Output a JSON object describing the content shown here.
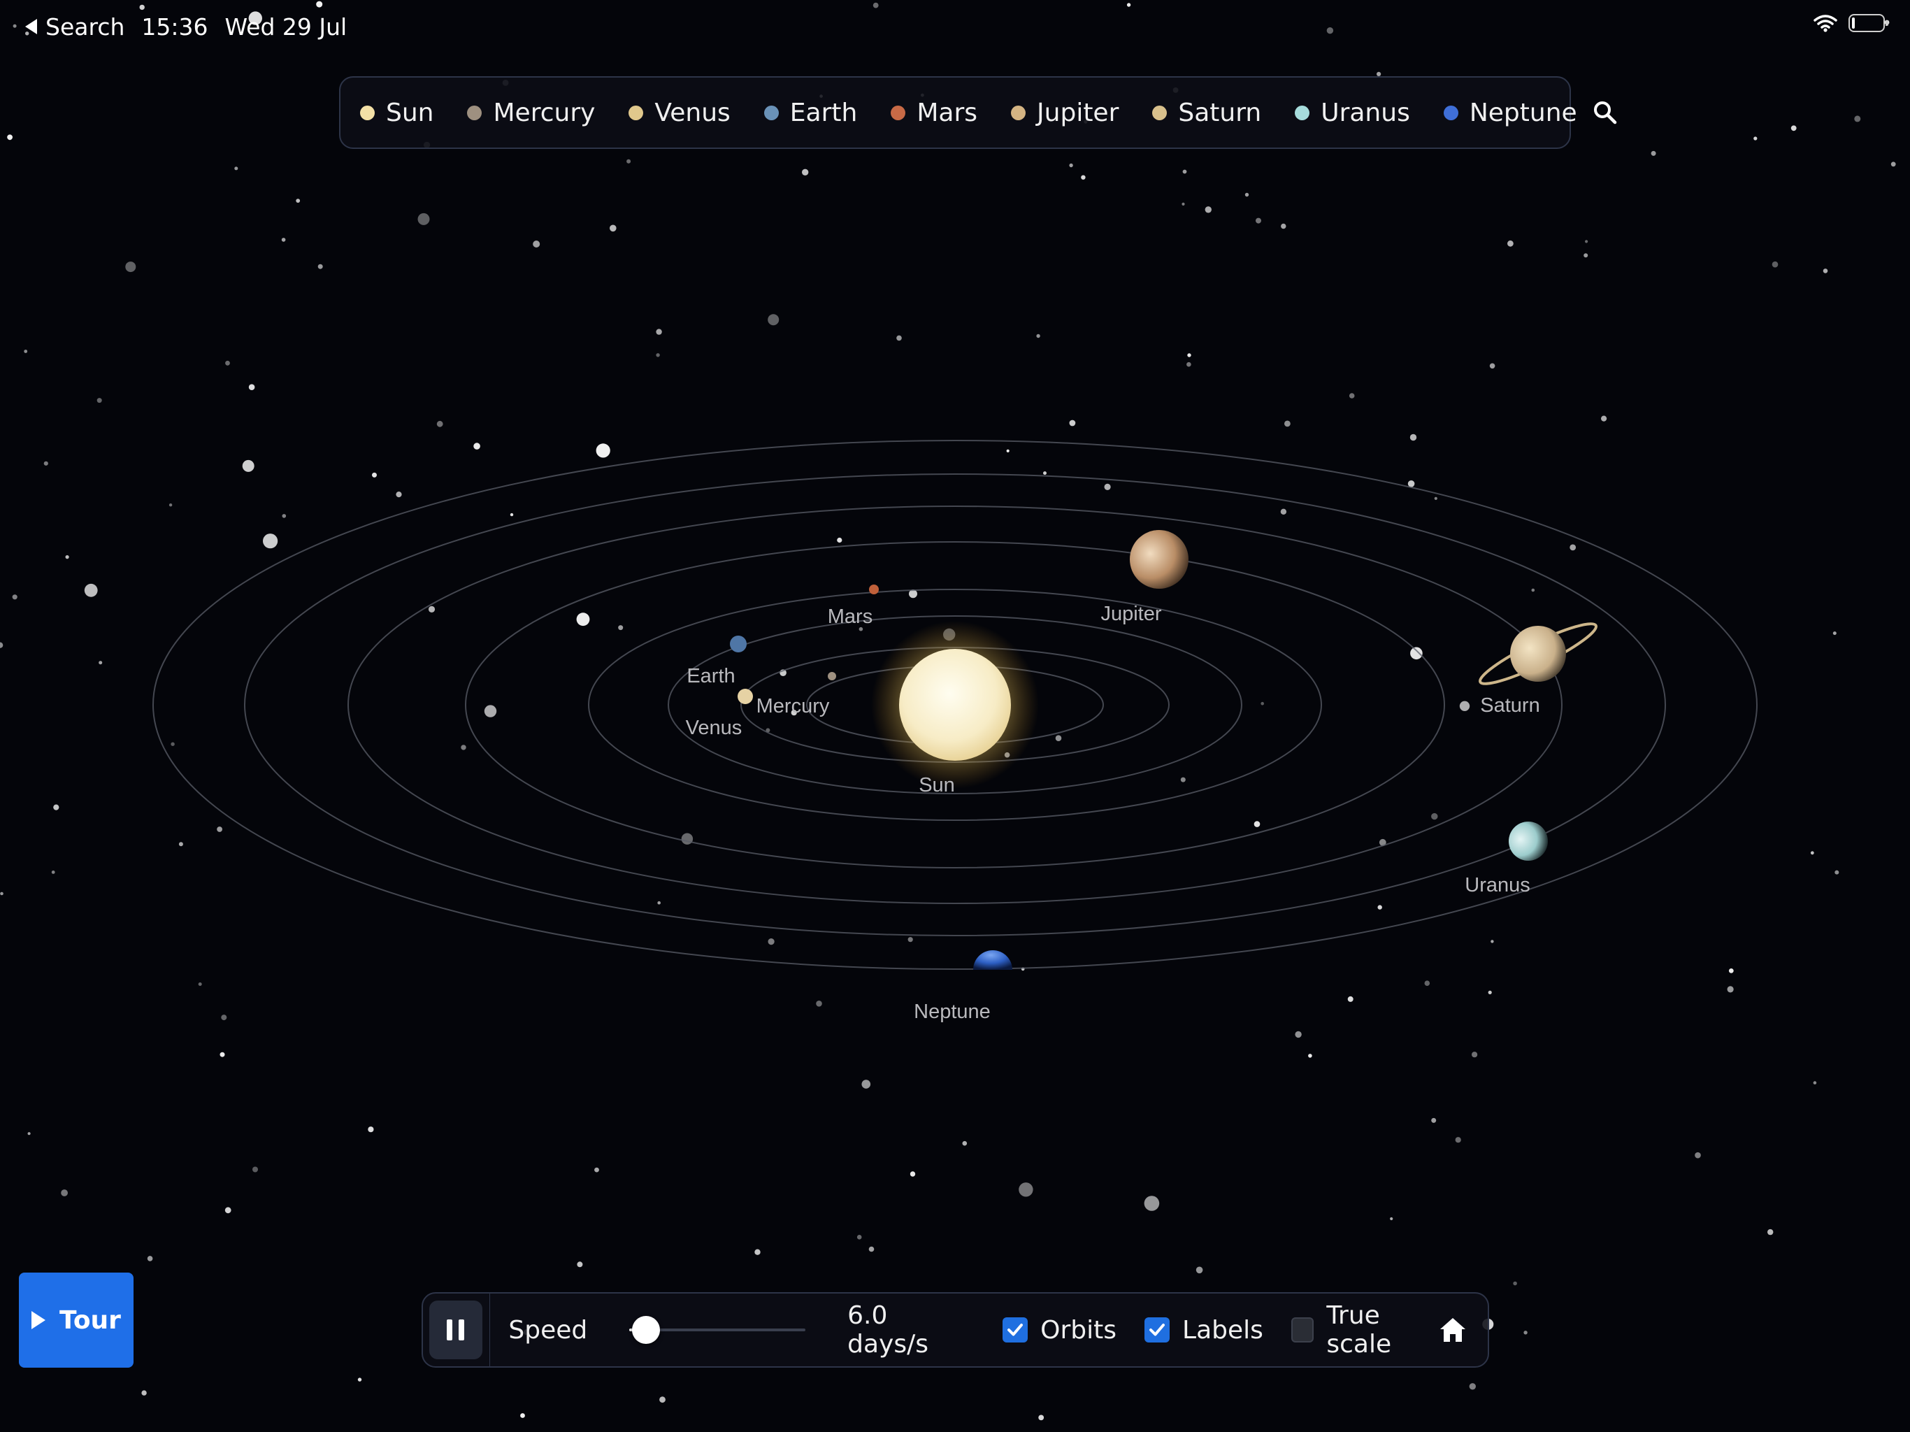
{
  "status_bar": {
    "back_label": "Search",
    "time": "15:36",
    "date": "Wed 29 Jul",
    "battery_level": 0.08
  },
  "planet_bar": {
    "items": [
      {
        "label": "Sun",
        "color": "#f3e0a6"
      },
      {
        "label": "Mercury",
        "color": "#9e9080"
      },
      {
        "label": "Venus",
        "color": "#e0c88c"
      },
      {
        "label": "Earth",
        "color": "#6a92b8"
      },
      {
        "label": "Mars",
        "color": "#c86a46"
      },
      {
        "label": "Jupiter",
        "color": "#d4b483"
      },
      {
        "label": "Saturn",
        "color": "#d8c08c"
      },
      {
        "label": "Uranus",
        "color": "#a6dcdc"
      },
      {
        "label": "Neptune",
        "color": "#3f6fd8"
      }
    ],
    "search_icon": "search-icon"
  },
  "scene": {
    "labels": {
      "sun": "Sun",
      "mercury": "Mercury",
      "venus": "Venus",
      "earth": "Earth",
      "mars": "Mars",
      "jupiter": "Jupiter",
      "saturn": "Saturn",
      "uranus": "Uranus",
      "neptune": "Neptune"
    }
  },
  "controls": {
    "pause_icon": "pause-icon",
    "speed_label": "Speed",
    "speed_slider_value": 0.05,
    "speed_value": "6.0 days/s",
    "orbits_label": "Orbits",
    "orbits_checked": true,
    "labels_label": "Labels",
    "labels_checked": true,
    "true_scale_label": "True scale",
    "true_scale_checked": false,
    "home_icon": "home-icon"
  },
  "tour_button": {
    "label": "Tour"
  },
  "colors": {
    "accent": "#1f6fe8",
    "background": "#04050a",
    "panel_border": "#2d3448"
  }
}
